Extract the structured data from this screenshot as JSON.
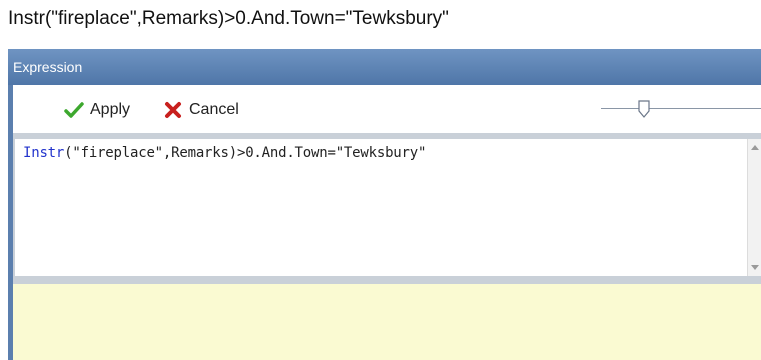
{
  "caption": "Instr(\"fireplace\",Remarks)>0.And.Town=\"Tewksbury\"",
  "window": {
    "title": "Expression"
  },
  "toolbar": {
    "apply_label": "Apply",
    "apply_icon": "checkmark-icon",
    "cancel_label": "Cancel",
    "cancel_icon": "x-icon",
    "zoom_slider_level": 0.25
  },
  "editor": {
    "function_name": "Instr",
    "expression_rest": "(\"fireplace\",Remarks)>0.And.Town=\"Tewksbury\""
  },
  "message": {
    "text": ""
  },
  "colors": {
    "title_bar": "#5b7fae",
    "apply_icon": "#3da82e",
    "cancel_icon": "#c8201e",
    "message_area": "#fafad2",
    "function_keyword": "#2233cc"
  }
}
